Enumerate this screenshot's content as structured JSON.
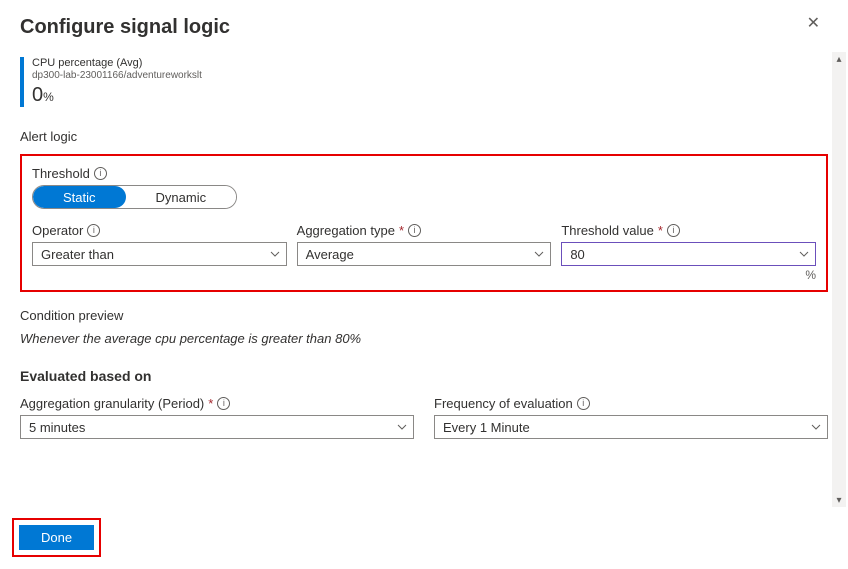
{
  "title": "Configure signal logic",
  "metric": {
    "name": "CPU percentage (Avg)",
    "resource": "dp300-lab-23001166/adventureworkslt",
    "value": "0",
    "unit": "%"
  },
  "alert_logic": {
    "section_label": "Alert logic",
    "threshold_label": "Threshold",
    "toggle": {
      "static": "Static",
      "dynamic": "Dynamic",
      "selected": "Static"
    },
    "operator": {
      "label": "Operator",
      "value": "Greater than"
    },
    "aggregation": {
      "label": "Aggregation type",
      "value": "Average"
    },
    "threshold_value": {
      "label": "Threshold value",
      "value": "80",
      "suffix": "%"
    }
  },
  "condition_preview": {
    "label": "Condition preview",
    "text": "Whenever the average cpu percentage is greater than 80%"
  },
  "evaluated": {
    "heading": "Evaluated based on",
    "granularity": {
      "label": "Aggregation granularity (Period)",
      "value": "5 minutes"
    },
    "frequency": {
      "label": "Frequency of evaluation",
      "value": "Every 1 Minute"
    }
  },
  "footer": {
    "done": "Done"
  }
}
